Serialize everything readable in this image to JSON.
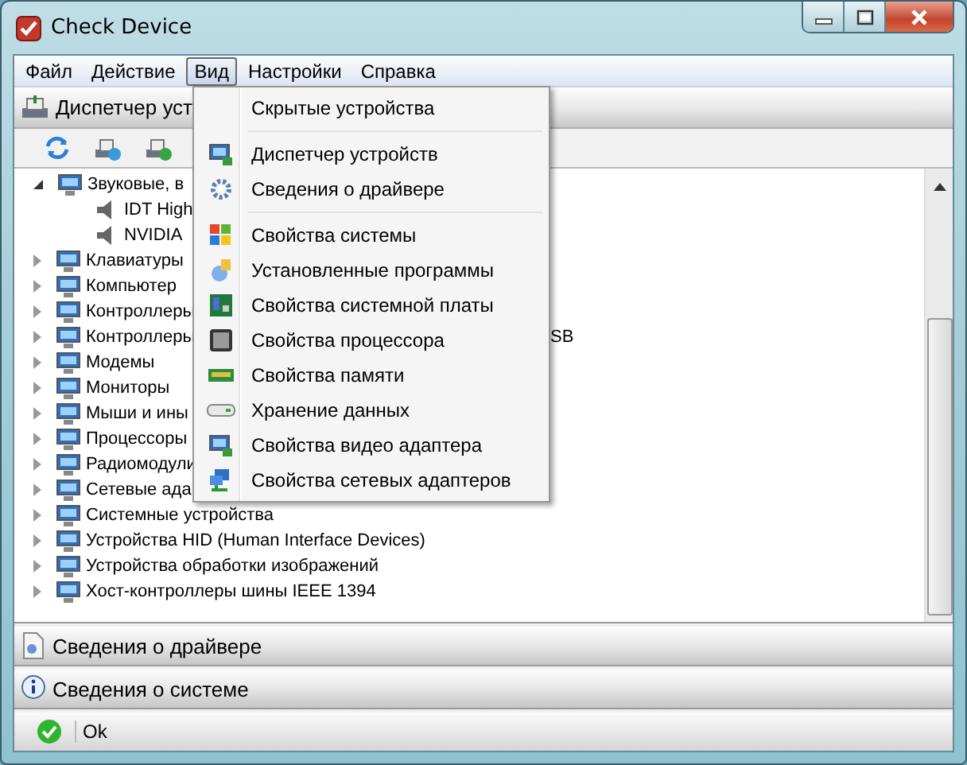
{
  "window": {
    "title": "Check Device"
  },
  "menu_bar": [
    {
      "label": "Файл",
      "selected": false
    },
    {
      "label": "Действие",
      "selected": false
    },
    {
      "label": "Вид",
      "selected": true
    },
    {
      "label": "Настройки",
      "selected": false
    },
    {
      "label": "Справка",
      "selected": false
    }
  ],
  "panel": {
    "title": "Диспетчер уст"
  },
  "tree": [
    {
      "label": "Звуковые, в",
      "expanded": true,
      "children": [
        {
          "label": "IDT High"
        },
        {
          "label": "NVIDIA"
        }
      ]
    },
    {
      "label": "Клавиатуры",
      "expanded": false
    },
    {
      "label": "Компьютер",
      "expanded": false
    },
    {
      "label": "Контроллеры",
      "expanded": false
    },
    {
      "label": "Контроллеры",
      "expanded": false,
      "tail": "SB"
    },
    {
      "label": "Модемы",
      "expanded": false
    },
    {
      "label": "Мониторы",
      "expanded": false
    },
    {
      "label": "Мыши и ины",
      "expanded": false
    },
    {
      "label": "Процессоры",
      "expanded": false
    },
    {
      "label": "Радиомодули",
      "expanded": false
    },
    {
      "label": "Сетевые ада",
      "expanded": false
    },
    {
      "label": "Системные устройства",
      "expanded": false
    },
    {
      "label": "Устройства HID (Human Interface Devices)",
      "expanded": false
    },
    {
      "label": "Устройства обработки изображений",
      "expanded": false
    },
    {
      "label": "Хост-контроллеры шины IEEE 1394",
      "expanded": false
    }
  ],
  "dropdown": [
    {
      "kind": "item",
      "label": "Скрытые устройства"
    },
    {
      "kind": "separator"
    },
    {
      "kind": "item",
      "label": "Диспетчер устройств"
    },
    {
      "kind": "item",
      "label": "Сведения о драйвере"
    },
    {
      "kind": "separator"
    },
    {
      "kind": "item",
      "label": "Свойства системы"
    },
    {
      "kind": "item",
      "label": "Установленные программы"
    },
    {
      "kind": "item",
      "label": "Свойства системной платы"
    },
    {
      "kind": "item",
      "label": "Свойства процессора"
    },
    {
      "kind": "item",
      "label": "Свойства памяти"
    },
    {
      "kind": "item",
      "label": "Хранение данных"
    },
    {
      "kind": "item",
      "label": "Свойства видео адаптера"
    },
    {
      "kind": "item",
      "label": "Свойства сетевых адаптеров"
    }
  ],
  "sections": [
    {
      "label": "Сведения о драйвере"
    },
    {
      "label": "Сведения о системе"
    }
  ],
  "status_bar": {
    "text": "Ok"
  }
}
